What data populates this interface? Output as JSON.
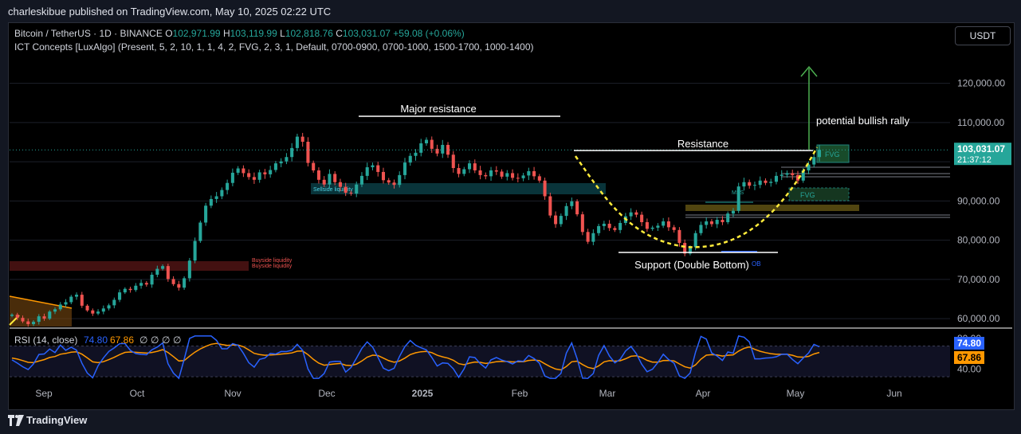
{
  "publisher_line": "charleskibue published on TradingView.com, May 10, 2025 02:22 UTC",
  "legend": {
    "symbol": "Bitcoin / TetherUS · 1D · BINANCE",
    "o_label": "O",
    "o": "102,971.99",
    "h_label": "H",
    "h": "103,119.99",
    "l_label": "L",
    "l": "102,818.76",
    "c_label": "C",
    "c": "103,031.07",
    "change": "+59.08 (+0.06%)",
    "indicator": "ICT Concepts [LuxAlgo] (Present, 5, 2, 10, 1, 1, 4, 2, FVG, 2, 3, 1, Default, 0700-0900, 0700-1000, 1500-1700, 1000-1400)"
  },
  "currency_button": "USDT",
  "brand": "TradingView",
  "chart_data": {
    "type": "line",
    "title": "",
    "price_axis": {
      "ticks": [
        60000,
        70000,
        80000,
        90000,
        100000,
        110000,
        120000
      ],
      "tick_labels": [
        "60,000.00",
        "70,000.00",
        "80,000.00",
        "90,000.00",
        "",
        "110,000.00",
        "120,000.00"
      ],
      "ylim": [
        58000,
        125000
      ]
    },
    "last_price": {
      "value": 103031.07,
      "label": "103,031.07",
      "countdown": "21:37:12",
      "color": "#26a69a"
    },
    "x_axis_labels": [
      "Sep",
      "Oct",
      "Nov",
      "Dec",
      "2025",
      "Feb",
      "Mar",
      "Apr",
      "May",
      "Jun"
    ],
    "series": [
      {
        "values": [
          61000,
          60200,
          59300,
          58600,
          59200,
          60600,
          60000,
          61800,
          62400,
          63600,
          64200,
          65600,
          66100,
          63300,
          62100,
          61300,
          61800,
          62600,
          63400,
          64800,
          66700,
          67600,
          67300,
          68400,
          69100,
          68700,
          71200,
          72700,
          73400,
          70100,
          68800,
          67900,
          70300,
          74800,
          79800,
          84500,
          88800,
          90500,
          91200,
          92800,
          94600,
          97200,
          98300,
          97100,
          96100,
          95400,
          97300,
          96800,
          97900,
          99600,
          100100,
          101200,
          103500,
          106400,
          105100,
          99700,
          97800,
          95400,
          94200,
          96900,
          94800,
          93600,
          92100,
          91900,
          94200,
          96400,
          98600,
          99100,
          97400,
          95300,
          94700,
          94100,
          96600,
          99800,
          101500,
          102300,
          104700,
          105600,
          103300,
          102100,
          104300,
          101800,
          98400,
          96900,
          98100,
          99600,
          97800,
          96600,
          96300,
          97800,
          97500,
          96200,
          97100,
          95900,
          95800,
          96500,
          97600,
          96300,
          95200,
          91200,
          86300,
          84100,
          86200,
          88700,
          89900,
          86600,
          82100,
          79600,
          81800,
          83600,
          84200,
          83100,
          82600,
          84400,
          86100,
          87100,
          86500,
          84600,
          82900,
          83200,
          83700,
          84800,
          83300,
          82600,
          79300,
          76600,
          78200,
          81800,
          83900,
          84800,
          84100,
          85200,
          84600,
          86800,
          87500,
          93700,
          94800,
          93900,
          94100,
          95200,
          94600,
          94900,
          96400,
          96700,
          97100,
          96600,
          95200,
          97800,
          99300,
          101200,
          103031
        ],
        "color": "#26a69a"
      }
    ],
    "rsi": {
      "label": "RSI (14, close)",
      "rsi_value": "74.80",
      "ma_value": "67.86",
      "extras": [
        "∅",
        "∅",
        "∅",
        "∅"
      ],
      "ticks": [
        40,
        80
      ],
      "tick_labels": [
        "40.00",
        "80.00"
      ],
      "ylim": [
        25,
        85
      ],
      "rsi_color": "#2962ff",
      "ma_color": "#ff9800"
    },
    "annotations": {
      "major_resistance": "Major resistance",
      "resistance": "Resistance",
      "support": "Support (Double Bottom)",
      "rally": "potential bullish rally",
      "fvg": "FVG",
      "fvg2": "FVG",
      "mss": "MSS",
      "sellside": "Sellside liquidity",
      "buyside1": "Buyside liquidity",
      "buyside2": "Buyside liquidity",
      "ob": "OB"
    }
  }
}
